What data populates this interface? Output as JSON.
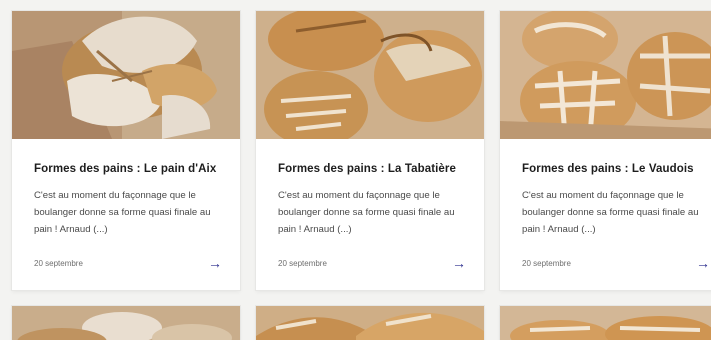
{
  "cards": [
    {
      "title": "Formes des pains : Le pain d'Aix",
      "excerpt": "C'est au moment du façonnage que le boulanger donne sa forme quasi finale au pain ! Arnaud (...)",
      "date": "20 septembre",
      "arrow": "→",
      "icon": "arrow-right-icon"
    },
    {
      "title": "Formes des pains : La Tabatière",
      "excerpt": "C'est au moment du façonnage que le boulanger donne sa forme quasi finale au pain ! Arnaud (...)",
      "date": "20 septembre",
      "arrow": "→",
      "icon": "arrow-right-icon"
    },
    {
      "title": "Formes des pains : Le Vaudois",
      "excerpt": "C'est au moment du façonnage que le boulanger donne sa forme quasi finale au pain ! Arnaud (...)",
      "date": "20 septembre",
      "arrow": "→",
      "icon": "arrow-right-icon"
    }
  ],
  "colors": {
    "accent": "#2d2f8f",
    "background": "#f3f3f1",
    "card": "#ffffff"
  }
}
